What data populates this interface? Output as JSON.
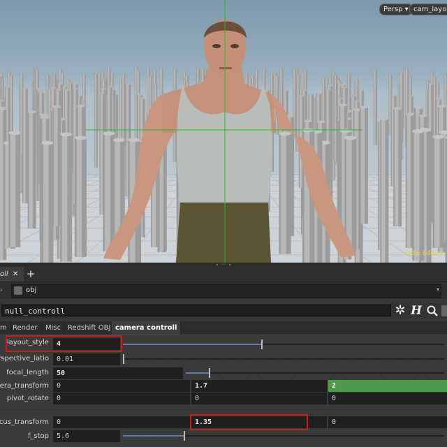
{
  "viewport": {
    "perspective_label": "Persp",
    "camera_label": "cam_layout",
    "watermark": "Indie Edition"
  },
  "pane_tab": {
    "label": "oll",
    "add_label": "+"
  },
  "path": {
    "value": "obj"
  },
  "node": {
    "name": "null_controll",
    "help_label": "H"
  },
  "param_tabs": [
    "m",
    "Render",
    "Misc",
    "Redshift OBJ",
    "camera controll"
  ],
  "active_tab_index": 4,
  "params": [
    {
      "label": "layout_style",
      "value": "4",
      "slider": 0.43
    },
    {
      "label": "perspective_latio",
      "value": "0.01",
      "slider": 0.0
    },
    {
      "label": "focal_length",
      "value": "50",
      "slider": 0.09
    },
    {
      "label": "camera_transform",
      "values": [
        "0",
        "1.7",
        "2"
      ]
    },
    {
      "label": "pivot_rotate",
      "values": [
        "0",
        "0",
        "0"
      ]
    },
    {
      "label": "focus_transform",
      "values": [
        "0",
        "1.35",
        "0"
      ]
    },
    {
      "label": "f_stop",
      "value": "5.6",
      "slider": 0.19
    }
  ],
  "colors": {
    "highlight": "#d01a1a",
    "active_field": "#4c9a4c",
    "slider": "#5a7fa8"
  }
}
